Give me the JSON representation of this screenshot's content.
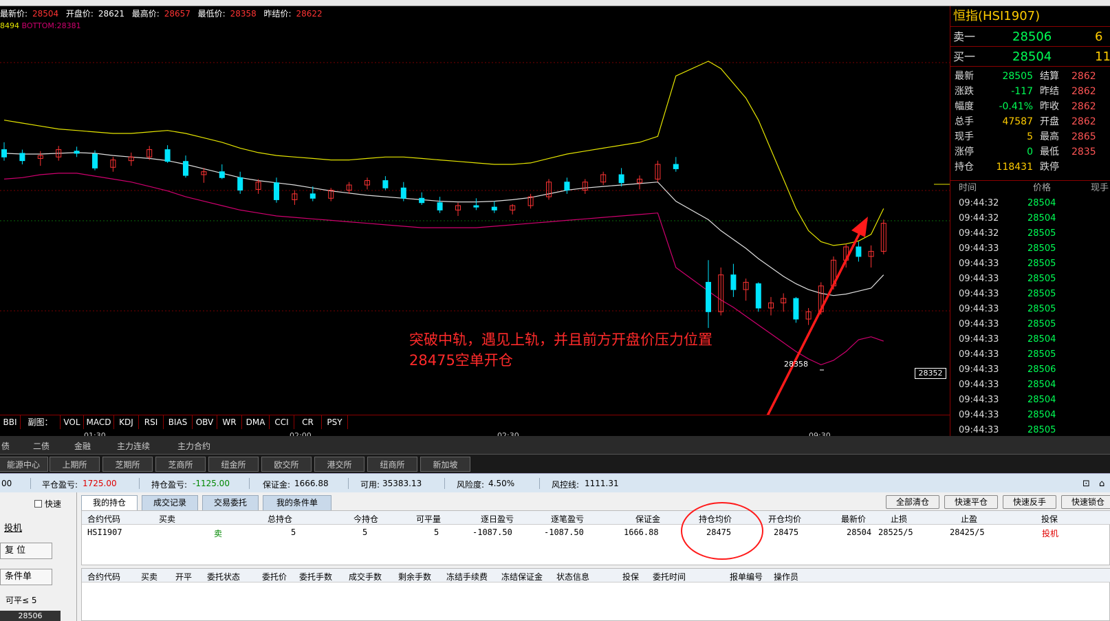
{
  "header": {
    "latest_label": "最新价:",
    "latest": "28504",
    "open_label": "开盘价:",
    "open": "28621",
    "high_label": "最高价:",
    "high": "28657",
    "low_label": "最低价:",
    "low": "28358",
    "prev_label": "昨结价:",
    "prev": "28622"
  },
  "boll": {
    "mid_text": "8494",
    "bottom_text": "BOTTOM:28381"
  },
  "chart": {
    "price_tag": "28352",
    "low_marker": "28358",
    "annotation_line1": "突破中轨，遇见上轨，并且前方开盘价压力位置",
    "annotation_line2": "28475空单开仓",
    "colors": {
      "up": "#ff3333",
      "down": "#00e5ff",
      "upper": "#e6e600",
      "mid": "#e0e0e0",
      "lower": "#d0006f",
      "arrow": "#ff1a1a"
    }
  },
  "chart_data": {
    "type": "candlestick",
    "title": "",
    "series": [
      {
        "name": "price",
        "ohlc": [
          [
            28600,
            28610,
            28585,
            28590
          ],
          [
            28595,
            28600,
            28580,
            28585
          ],
          [
            28588,
            28598,
            28578,
            28592
          ],
          [
            28590,
            28605,
            28585,
            28600
          ],
          [
            28598,
            28604,
            28590,
            28595
          ],
          [
            28594,
            28599,
            28572,
            28575
          ],
          [
            28576,
            28590,
            28570,
            28586
          ],
          [
            28585,
            28596,
            28578,
            28590
          ],
          [
            28590,
            28605,
            28586,
            28600
          ],
          [
            28600,
            28606,
            28582,
            28584
          ],
          [
            28584,
            28592,
            28562,
            28565
          ],
          [
            28566,
            28575,
            28555,
            28570
          ],
          [
            28570,
            28580,
            28560,
            28562
          ],
          [
            28562,
            28570,
            28540,
            28545
          ],
          [
            28546,
            28560,
            28540,
            28556
          ],
          [
            28555,
            28562,
            28528,
            28532
          ],
          [
            28532,
            28545,
            28525,
            28540
          ],
          [
            28540,
            28550,
            28530,
            28534
          ],
          [
            28534,
            28548,
            28530,
            28545
          ],
          [
            28545,
            28556,
            28540,
            28552
          ],
          [
            28552,
            28562,
            28546,
            28558
          ],
          [
            28558,
            28564,
            28545,
            28548
          ],
          [
            28548,
            28556,
            28530,
            28534
          ],
          [
            28534,
            28542,
            28525,
            28528
          ],
          [
            28528,
            28536,
            28514,
            28518
          ],
          [
            28518,
            28528,
            28510,
            28524
          ],
          [
            28524,
            28534,
            28518,
            28522
          ],
          [
            28522,
            28530,
            28514,
            28518
          ],
          [
            28518,
            28526,
            28512,
            28524
          ],
          [
            28524,
            28540,
            28520,
            28536
          ],
          [
            28536,
            28560,
            28532,
            28556
          ],
          [
            28556,
            28562,
            28540,
            28545
          ],
          [
            28545,
            28560,
            28540,
            28556
          ],
          [
            28556,
            28570,
            28552,
            28566
          ],
          [
            28566,
            28575,
            28550,
            28555
          ],
          [
            28555,
            28565,
            28546,
            28560
          ],
          [
            28560,
            28585,
            28556,
            28580
          ],
          [
            28580,
            28590,
            28570,
            28574
          ],
          [
            28420,
            28450,
            28358,
            28380
          ],
          [
            28380,
            28440,
            28375,
            28430
          ],
          [
            28430,
            28445,
            28400,
            28410
          ],
          [
            28410,
            28425,
            28395,
            28420
          ],
          [
            28418,
            28420,
            28380,
            28385
          ],
          [
            28385,
            28400,
            28375,
            28392
          ],
          [
            28392,
            28405,
            28380,
            28398
          ],
          [
            28398,
            28400,
            28365,
            28370
          ],
          [
            28370,
            28385,
            28362,
            28380
          ],
          [
            28380,
            28420,
            28376,
            28415
          ],
          [
            28415,
            28455,
            28410,
            28450
          ],
          [
            28450,
            28472,
            28440,
            28468
          ],
          [
            28468,
            28475,
            28448,
            28455
          ],
          [
            28455,
            28470,
            28440,
            28462
          ],
          [
            28462,
            28505,
            28458,
            28500
          ]
        ]
      },
      {
        "name": "upper",
        "values": [
          28640,
          28636,
          28632,
          28628,
          28626,
          28624,
          28622,
          28622,
          28624,
          28626,
          28622,
          28616,
          28610,
          28602,
          28596,
          28592,
          28590,
          28588,
          28586,
          28586,
          28588,
          28590,
          28590,
          28588,
          28586,
          28584,
          28582,
          28580,
          28580,
          28582,
          28588,
          28594,
          28598,
          28602,
          28606,
          28610,
          28618,
          28700,
          28720,
          28710,
          28690,
          28670,
          28640,
          28600,
          28560,
          28520,
          28490,
          28475,
          28470,
          28472,
          28476,
          28485,
          28520
        ]
      },
      {
        "name": "mid",
        "values": [
          28595,
          28594,
          28594,
          28595,
          28596,
          28595,
          28592,
          28590,
          28588,
          28585,
          28580,
          28574,
          28568,
          28562,
          28558,
          28555,
          28552,
          28548,
          28544,
          28541,
          28538,
          28536,
          28534,
          28532,
          28530,
          28529,
          28529,
          28530,
          28532,
          28535,
          28540,
          28545,
          28548,
          28550,
          28552,
          28554,
          28556,
          28530,
          28505,
          28490,
          28478,
          28466,
          28452,
          28440,
          28428,
          28418,
          28410,
          28405,
          28402,
          28404,
          28408,
          28412,
          28430
        ]
      },
      {
        "name": "lower",
        "values": [
          28560,
          28562,
          28566,
          28568,
          28568,
          28564,
          28560,
          28556,
          28550,
          28544,
          28536,
          28530,
          28524,
          28518,
          28514,
          28510,
          28508,
          28506,
          28504,
          28502,
          28500,
          28498,
          28496,
          28494,
          28494,
          28494,
          28494,
          28496,
          28498,
          28500,
          28502,
          28504,
          28506,
          28508,
          28510,
          28512,
          28514,
          28440,
          28408,
          28396,
          28386,
          28374,
          28362,
          28350,
          28338,
          28326,
          28316,
          28308,
          28314,
          28326,
          28342,
          28346,
          28340
        ]
      }
    ],
    "x_ticks": [
      "01:30",
      "02:00",
      "02:30",
      "09:30"
    ]
  },
  "indicators": [
    "BBI",
    "副图：",
    "VOL",
    "MACD",
    "KDJ",
    "RSI",
    "BIAS",
    "OBV",
    "WR",
    "DMA",
    "CCI",
    "CR",
    "PSY"
  ],
  "quote": {
    "title": "恒指(HSI1907)",
    "sell1_label": "卖一",
    "sell1_price": "28506",
    "sell1_vol": "6",
    "buy1_label": "买一",
    "buy1_price": "28504",
    "buy1_vol": "11",
    "rows": [
      {
        "l1": "最新",
        "v1": "28505",
        "c1": "#00ff55",
        "l2": "结算",
        "v2": "2862"
      },
      {
        "l1": "涨跌",
        "v1": "-117",
        "c1": "#00ff55",
        "l2": "昨结",
        "v2": "2862"
      },
      {
        "l1": "幅度",
        "v1": "-0.41%",
        "c1": "#00ff55",
        "l2": "昨收",
        "v2": "2862"
      },
      {
        "l1": "总手",
        "v1": "47587",
        "c1": "#ffcc00",
        "l2": "开盘",
        "v2": "2862"
      },
      {
        "l1": "现手",
        "v1": "5",
        "c1": "#ffcc00",
        "l2": "最高",
        "v2": "2865"
      },
      {
        "l1": "涨停",
        "v1": "0",
        "c1": "#00ff55",
        "l2": "最低",
        "v2": "2835"
      },
      {
        "l1": "持仓",
        "v1": "118431",
        "c1": "#ffcc00",
        "l2": "跌停",
        "v2": ""
      }
    ],
    "tick_header": {
      "time": "时间",
      "price": "价格",
      "vol": "现手"
    },
    "ticks": [
      {
        "time": "09:44:32",
        "price": "28504"
      },
      {
        "time": "09:44:32",
        "price": "28504"
      },
      {
        "time": "09:44:32",
        "price": "28505"
      },
      {
        "time": "09:44:33",
        "price": "28505"
      },
      {
        "time": "09:44:33",
        "price": "28505"
      },
      {
        "time": "09:44:33",
        "price": "28505"
      },
      {
        "time": "09:44:33",
        "price": "28505"
      },
      {
        "time": "09:44:33",
        "price": "28505"
      },
      {
        "time": "09:44:33",
        "price": "28505"
      },
      {
        "time": "09:44:33",
        "price": "28504"
      },
      {
        "time": "09:44:33",
        "price": "28505"
      },
      {
        "time": "09:44:33",
        "price": "28506"
      },
      {
        "time": "09:44:33",
        "price": "28504"
      },
      {
        "time": "09:44:33",
        "price": "28504"
      },
      {
        "time": "09:44:33",
        "price": "28504"
      },
      {
        "time": "09:44:33",
        "price": "28505"
      }
    ]
  },
  "categories": [
    "债",
    "二债",
    "金融",
    "主力连续",
    "主力合约"
  ],
  "exchanges": [
    "能源中心",
    "上期所",
    "芝期所",
    "芝商所",
    "纽金所",
    "欧交所",
    "港交所",
    "纽商所",
    "新加坡"
  ],
  "account": {
    "lead": "00",
    "close_pl_label": "平仓盈亏:",
    "close_pl": "1725.00",
    "hold_pl_label": "持仓盈亏:",
    "hold_pl": "-1125.00",
    "margin_label": "保证金:",
    "margin": "1666.88",
    "avail_label": "可用:",
    "avail": "35383.13",
    "risk_label": "风险度:",
    "risk": "4.50%",
    "ctrl_label": "风控线:",
    "ctrl": "1111.31"
  },
  "left_panel": {
    "quick_label": "快速",
    "btn1": "投机",
    "btn2": "复 位",
    "btn3": "条件单",
    "keping": "可平≤ 5",
    "bottom_price": "28506"
  },
  "tabs": [
    "我的持仓",
    "成交记录",
    "交易委托",
    "我的条件单"
  ],
  "actions": [
    "全部清仓",
    "快速平仓",
    "快速反手",
    "快速锁仓"
  ],
  "positions": {
    "headers": [
      "合约代码",
      "买卖",
      "总持仓",
      "今持仓",
      "可平量",
      "逐日盈亏",
      "逐笔盈亏",
      "保证金",
      "持仓均价",
      "开仓均价",
      "最新价",
      "止损",
      "止盈",
      "投保"
    ],
    "rows": [
      {
        "code": "HSI1907",
        "side": "卖",
        "total": "5",
        "today": "5",
        "closable": "5",
        "daily_pl": "-1087.50",
        "trade_pl": "-1087.50",
        "margin": "1666.88",
        "hold_avg": "28475",
        "open_avg": "28475",
        "last": "28504",
        "stop_loss": "28525/5",
        "take_profit": "28425/5",
        "hedge": "投机"
      }
    ]
  },
  "orders": {
    "headers": [
      "合约代码",
      "买卖",
      "开平",
      "委托状态",
      "委托价",
      "委托手数",
      "成交手数",
      "剩余手数",
      "冻结手续费",
      "冻结保证金",
      "状态信息",
      "投保",
      "委托时间",
      "报单编号",
      "操作员"
    ]
  }
}
